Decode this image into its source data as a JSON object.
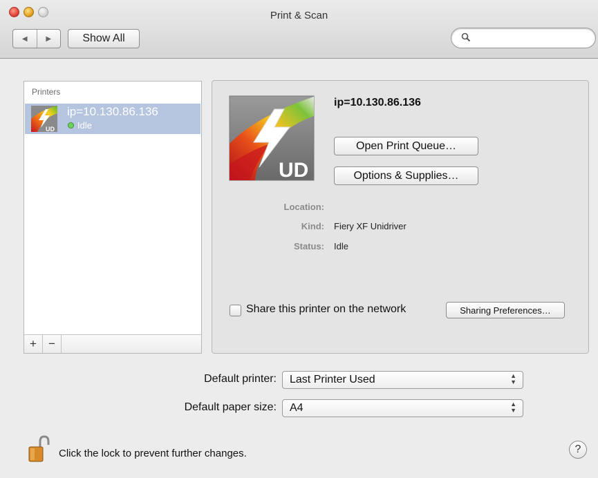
{
  "window": {
    "title": "Print & Scan"
  },
  "toolbar": {
    "back_icon": "◀",
    "forward_icon": "▶",
    "show_all_label": "Show All",
    "search_placeholder": ""
  },
  "printers_list": {
    "header": "Printers",
    "items": [
      {
        "name": "ip=10.130.86.136",
        "status": "Idle",
        "icon": "fiery-ud-printer-icon"
      }
    ],
    "add_label": "+",
    "remove_label": "−"
  },
  "detail": {
    "printer_name": "ip=10.130.86.136",
    "icon_badge": "UD",
    "open_queue_label": "Open Print Queue…",
    "options_label": "Options & Supplies…",
    "location_label": "Location:",
    "location_value": "",
    "kind_label": "Kind:",
    "kind_value": "Fiery XF Unidriver",
    "status_label": "Status:",
    "status_value": "Idle",
    "share_label": "Share this printer on the network",
    "share_checked": false,
    "sharing_prefs_label": "Sharing Preferences…"
  },
  "defaults": {
    "default_printer_label": "Default printer:",
    "default_printer_value": "Last Printer Used",
    "paper_size_label": "Default paper size:",
    "paper_size_value": "A4"
  },
  "footer": {
    "lock_text": "Click the lock to prevent further changes.",
    "help_label": "?"
  },
  "colors": {
    "selection": "#b5c4df",
    "status_dot": "#6bd35c"
  }
}
